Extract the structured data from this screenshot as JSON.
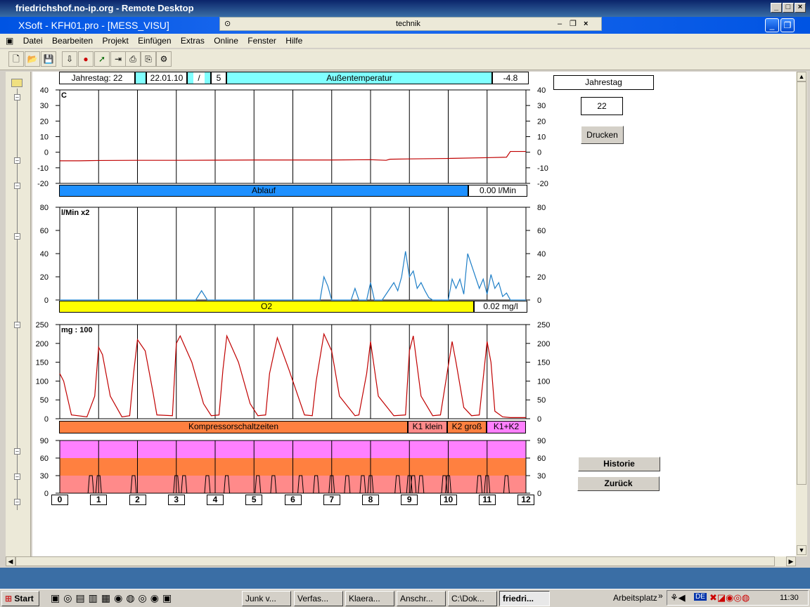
{
  "rdp": {
    "title": "friedrichshof.no-ip.org - Remote Desktop"
  },
  "app": {
    "title": "XSoft - KFH01.pro - [MESS_VISU]",
    "inner_window": "technik"
  },
  "menu": [
    "Datei",
    "Bearbeiten",
    "Projekt",
    "Einfügen",
    "Extras",
    "Online",
    "Fenster",
    "Hilfe"
  ],
  "header": {
    "jahrestag_label": "Jahrestag: 22",
    "date": "22.01.10",
    "slash": "/",
    "count": "5",
    "temp_title": "Außentemperatur",
    "temp_value": "-4.8"
  },
  "side": {
    "jahrestag_title": "Jahrestag",
    "jahrestag_value": "22",
    "print": "Drucken",
    "historie": "Historie",
    "zurueck": "Zurück"
  },
  "ablauf": {
    "title": "Ablauf",
    "value": "0.00 l/Min"
  },
  "o2": {
    "title": "O2",
    "value": "0.02 mg/l"
  },
  "kompressor": {
    "title": "Kompressorschaltzeiten",
    "k1": "K1 klein",
    "k2": "K2 groß",
    "k12": "K1+K2"
  },
  "chart_data": [
    {
      "type": "line",
      "title": "",
      "unit_label": "C",
      "ylim": [
        -20,
        40
      ],
      "yticks": [
        40,
        30,
        20,
        10,
        0,
        -10,
        -20
      ],
      "series": [
        {
          "color": "#c00000",
          "x": [
            0,
            0.5,
            1,
            2,
            3,
            4,
            5,
            6,
            7,
            8,
            8.4,
            8.5,
            9,
            10,
            11,
            11.5,
            11.6,
            12
          ],
          "y": [
            -5.5,
            -5.5,
            -5.3,
            -5.2,
            -5.2,
            -5.1,
            -5.0,
            -5.0,
            -5.0,
            -4.8,
            -5.2,
            -4.5,
            -4.3,
            -4.0,
            -3.5,
            -3.2,
            0.5,
            0.5
          ]
        }
      ]
    },
    {
      "type": "line",
      "title": "",
      "unit_label": "l/Min x2",
      "ylim": [
        0,
        80
      ],
      "yticks": [
        80,
        60,
        40,
        20,
        0
      ],
      "series": [
        {
          "color": "#1f7fc7",
          "x": [
            0,
            3.5,
            3.65,
            3.8,
            6.7,
            6.8,
            6.9,
            7.0,
            7.1,
            7.5,
            7.6,
            7.7,
            7.9,
            8.0,
            8.1,
            8.3,
            8.5,
            8.6,
            8.7,
            8.8,
            8.9,
            9.0,
            9.1,
            9.2,
            9.3,
            9.4,
            9.5,
            9.6,
            9.8,
            10.0,
            10.1,
            10.2,
            10.3,
            10.4,
            10.5,
            10.6,
            10.7,
            10.8,
            10.9,
            11.0,
            11.1,
            11.2,
            11.3,
            11.4,
            11.5,
            11.6,
            11.7,
            12
          ],
          "y": [
            0,
            0,
            8,
            0,
            0,
            20,
            12,
            0,
            0,
            0,
            10,
            0,
            0,
            15,
            0,
            0,
            10,
            15,
            8,
            20,
            42,
            20,
            25,
            10,
            15,
            8,
            2,
            0,
            0,
            0,
            18,
            10,
            18,
            5,
            40,
            30,
            20,
            10,
            18,
            5,
            22,
            10,
            15,
            3,
            6,
            0,
            0,
            0
          ]
        }
      ]
    },
    {
      "type": "line",
      "title": "",
      "unit_label": "mg : 100",
      "ylim": [
        0,
        250
      ],
      "yticks": [
        250,
        200,
        150,
        100,
        50,
        0
      ],
      "series": [
        {
          "color": "#c00000",
          "x": [
            0,
            0.1,
            0.3,
            0.7,
            0.9,
            1.0,
            1.1,
            1.3,
            1.6,
            1.8,
            1.9,
            2.0,
            2.2,
            2.4,
            2.5,
            2.9,
            3.0,
            3.1,
            3.4,
            3.7,
            3.9,
            4.1,
            4.2,
            4.3,
            4.6,
            4.9,
            5.1,
            5.3,
            5.4,
            5.6,
            5.9,
            6.3,
            6.5,
            6.6,
            6.8,
            7.0,
            7.2,
            7.6,
            7.7,
            7.9,
            8.0,
            8.2,
            8.6,
            8.9,
            9.0,
            9.1,
            9.3,
            9.6,
            9.8,
            10.1,
            10.2,
            10.4,
            10.6,
            10.8,
            11.0,
            11.1,
            11.2,
            11.4,
            11.6,
            12
          ],
          "y": [
            120,
            100,
            10,
            5,
            60,
            190,
            170,
            60,
            5,
            8,
            120,
            210,
            180,
            70,
            10,
            8,
            200,
            220,
            150,
            40,
            8,
            10,
            130,
            220,
            150,
            40,
            8,
            10,
            120,
            215,
            130,
            10,
            8,
            100,
            225,
            180,
            60,
            8,
            10,
            120,
            205,
            60,
            8,
            10,
            180,
            220,
            60,
            8,
            10,
            205,
            150,
            30,
            8,
            10,
            205,
            150,
            20,
            5,
            3,
            3
          ]
        }
      ]
    },
    {
      "type": "area",
      "title": "",
      "ylim": [
        0,
        90
      ],
      "yticks": [
        90,
        60,
        30,
        0
      ],
      "bands": [
        {
          "from": 0,
          "to": 30,
          "color": "#ff8a8a"
        },
        {
          "from": 30,
          "to": 60,
          "color": "#ff8040"
        },
        {
          "from": 60,
          "to": 90,
          "color": "#ff80ff"
        }
      ],
      "pulses_x": [
        0.8,
        1.0,
        1.9,
        3.0,
        3.2,
        3.8,
        4.3,
        5.1,
        5.5,
        6.2,
        6.6,
        7.0,
        7.4,
        7.8,
        8.0,
        8.7,
        9.0,
        9.1,
        9.3,
        9.9,
        10.0,
        10.8,
        11.0,
        11.5
      ],
      "pulse_value": 30,
      "xticks": [
        "0",
        "1",
        "2",
        "3",
        "4",
        "5",
        "6",
        "7",
        "8",
        "9",
        "10",
        "11",
        "12"
      ]
    }
  ],
  "taskbar": {
    "start": "Start",
    "items": [
      "Junk v...",
      "Verfas...",
      "Klaera...",
      "Anschr...",
      "C:\\Dok...",
      "friedri..."
    ],
    "arbeitsplatz": "Arbeitsplatz",
    "lang": "DE",
    "clock": "11:30"
  }
}
